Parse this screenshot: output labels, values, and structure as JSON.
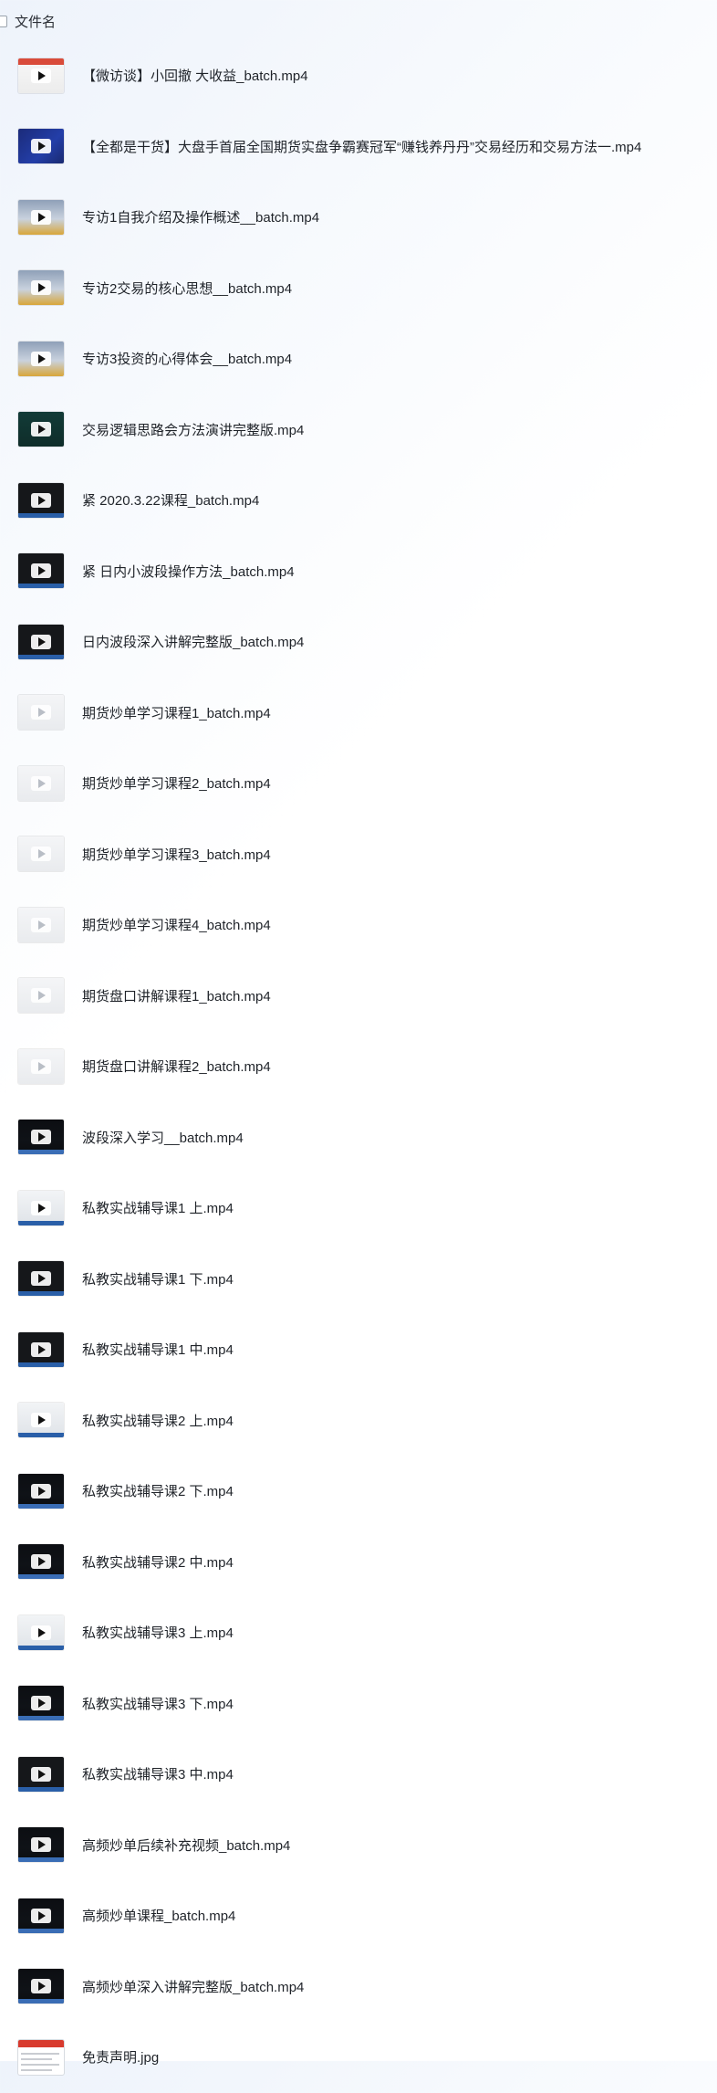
{
  "header": {
    "column_label": "文件名"
  },
  "files": [
    {
      "name": "【微访谈】小回撤 大收益_batch.mp4",
      "thumb": "red"
    },
    {
      "name": "【全都是干货】大盘手首届全国期货实盘争霸赛冠军“赚钱养丹丹”交易经历和交易方法一.mp4",
      "thumb": "blue"
    },
    {
      "name": "专访1自我介绍及操作概述__batch.mp4",
      "thumb": "person"
    },
    {
      "name": "专访2交易的核心思想__batch.mp4",
      "thumb": "person"
    },
    {
      "name": "专访3投资的心得体会__batch.mp4",
      "thumb": "person"
    },
    {
      "name": "交易逻辑思路会方法演讲完整版.mp4",
      "thumb": "green"
    },
    {
      "name": "紧 2020.3.22课程_batch.mp4",
      "thumb": "dark"
    },
    {
      "name": "紧 日内小波段操作方法_batch.mp4",
      "thumb": "dark"
    },
    {
      "name": "日内波段深入讲解完整版_batch.mp4",
      "thumb": "dark"
    },
    {
      "name": "期货炒单学习课程1_batch.mp4",
      "thumb": "light"
    },
    {
      "name": "期货炒单学习课程2_batch.mp4",
      "thumb": "light"
    },
    {
      "name": "期货炒单学习课程3_batch.mp4",
      "thumb": "light"
    },
    {
      "name": "期货炒单学习课程4_batch.mp4",
      "thumb": "light"
    },
    {
      "name": "期货盘口讲解课程1_batch.mp4",
      "thumb": "light"
    },
    {
      "name": "期货盘口讲解课程2_batch.mp4",
      "thumb": "light"
    },
    {
      "name": "波段深入学习__batch.mp4",
      "thumb": "chart"
    },
    {
      "name": "私教实战辅导课1 上.mp4",
      "thumb": "panel"
    },
    {
      "name": "私教实战辅导课1 下.mp4",
      "thumb": "dark"
    },
    {
      "name": "私教实战辅导课1 中.mp4",
      "thumb": "dark"
    },
    {
      "name": "私教实战辅导课2 上.mp4",
      "thumb": "panel"
    },
    {
      "name": "私教实战辅导课2 下.mp4",
      "thumb": "chart"
    },
    {
      "name": "私教实战辅导课2 中.mp4",
      "thumb": "chart"
    },
    {
      "name": "私教实战辅导课3 上.mp4",
      "thumb": "panel"
    },
    {
      "name": "私教实战辅导课3 下.mp4",
      "thumb": "chart"
    },
    {
      "name": "私教实战辅导课3 中.mp4",
      "thumb": "dark"
    },
    {
      "name": "高频炒单后续补充视频_batch.mp4",
      "thumb": "chart"
    },
    {
      "name": "高频炒单课程_batch.mp4",
      "thumb": "chart"
    },
    {
      "name": "高频炒单深入讲解完整版_batch.mp4",
      "thumb": "chart"
    },
    {
      "name": "免责声明.jpg",
      "thumb": "doc"
    }
  ]
}
